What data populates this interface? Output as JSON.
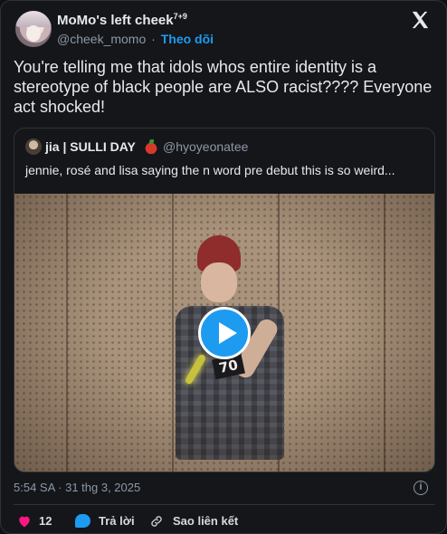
{
  "author": {
    "display_name": "MoMo's left cheek",
    "name_suffix": "7+9",
    "handle": "@cheek_momo",
    "separator": "·",
    "follow_label": "Theo dõi"
  },
  "tweet": {
    "text": "You're telling me that idols whos entire identity is a stereotype of black people are ALSO racist???? Everyone act shocked!"
  },
  "quoted": {
    "display_name": "jia | SULLI DAY",
    "emoji_icon": "apple-icon",
    "handle": "@hyoyeonatee",
    "text": "jennie, rosé and lisa saying the n word pre debut this is so weird...",
    "video_jersey_number": "70"
  },
  "meta": {
    "timestamp": "5:54 SA · 31 thg 3, 2025"
  },
  "actions": {
    "like_count": "12",
    "reply_label": "Trả lời",
    "copy_link_label": "Sao liên kết"
  },
  "colors": {
    "accent": "#1d9bf0",
    "like": "#f91880",
    "background": "#15161a",
    "text": "#e7e9ea",
    "muted": "#8b98a5"
  }
}
